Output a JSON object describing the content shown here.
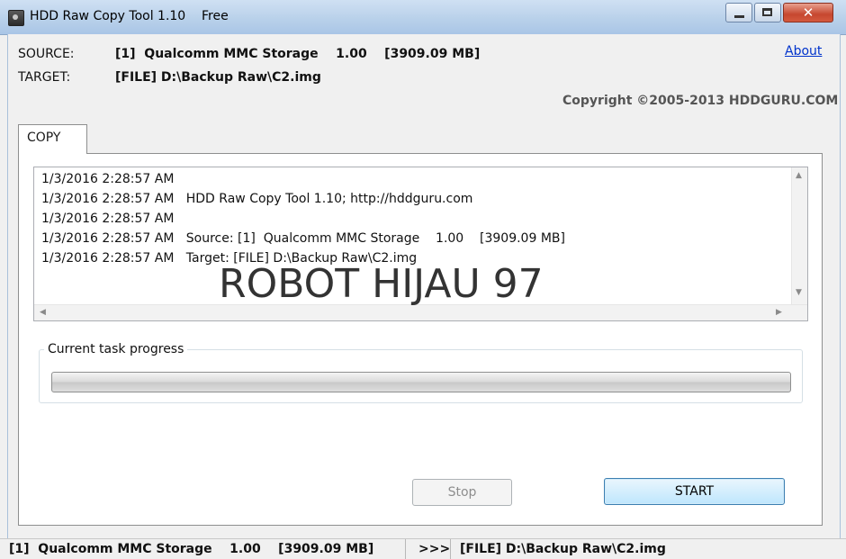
{
  "window": {
    "title": "HDD Raw Copy Tool 1.10    Free",
    "close_glyph": "✕"
  },
  "info": {
    "source_label": "SOURCE:",
    "source_value": "[1]  Qualcomm MMC Storage    1.00    [3909.09 MB]",
    "target_label": "TARGET:",
    "target_value": "[FILE] D:\\Backup Raw\\C2.img",
    "about_link": "About",
    "copyright": "Copyright ©2005-2013 HDDGURU.COM"
  },
  "tabs": [
    {
      "label": "COPY"
    }
  ],
  "log": {
    "lines": [
      "1/3/2016 2:28:57 AM",
      "1/3/2016 2:28:57 AM   HDD Raw Copy Tool 1.10; http://hddguru.com",
      "1/3/2016 2:28:57 AM",
      "1/3/2016 2:28:57 AM   Source: [1]  Qualcomm MMC Storage    1.00    [3909.09 MB]",
      "1/3/2016 2:28:57 AM   Target: [FILE] D:\\Backup Raw\\C2.img"
    ],
    "watermark": "ROBOT HIJAU 97"
  },
  "progress": {
    "label": "Current task progress",
    "value_percent": 0
  },
  "buttons": {
    "stop": "Stop",
    "start": "START"
  },
  "statusbar": {
    "source": "[1]  Qualcomm MMC Storage    1.00    [3909.09 MB]",
    "arrow": ">>>",
    "target": "[FILE] D:\\Backup Raw\\C2.img"
  },
  "colors": {
    "link": "#0033cc",
    "close_button": "#c6472f",
    "start_border": "#3c7fb1"
  }
}
